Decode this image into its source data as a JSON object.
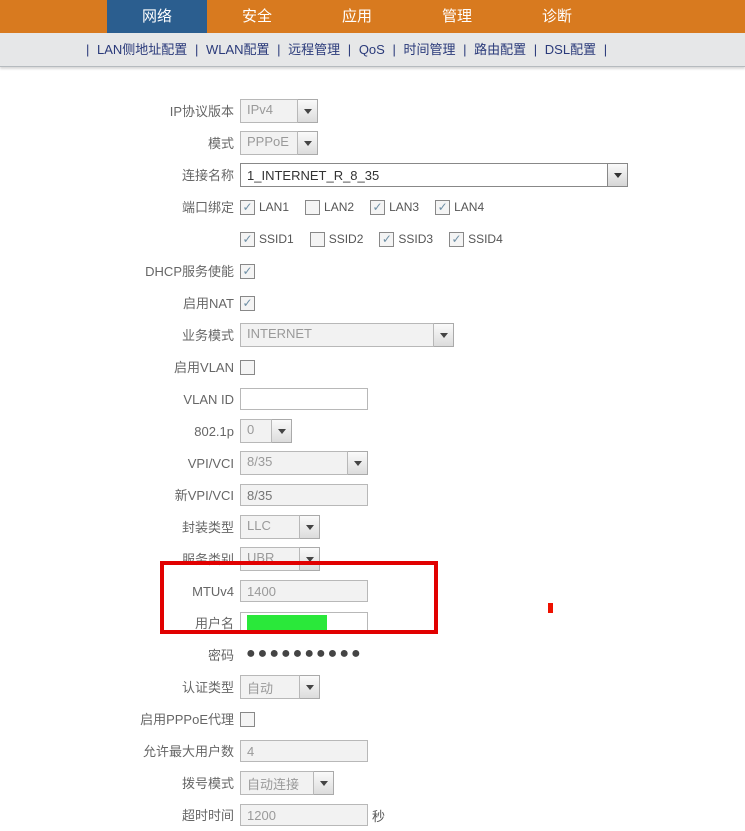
{
  "topnav": {
    "tabs": [
      "网络",
      "安全",
      "应用",
      "管理",
      "诊断"
    ],
    "active_index": 0
  },
  "subnav": {
    "items": [
      "LAN侧地址配置",
      "WLAN配置",
      "远程管理",
      "QoS",
      "时间管理",
      "路由配置",
      "DSL配置"
    ]
  },
  "form": {
    "ip_version": {
      "label": "IP协议版本",
      "value": "IPv4"
    },
    "mode": {
      "label": "模式",
      "value": "PPPoE"
    },
    "conn_name": {
      "label": "连接名称",
      "value": "1_INTERNET_R_8_35"
    },
    "port_bind": {
      "label": "端口绑定",
      "lans": [
        {
          "name": "LAN1",
          "checked": true
        },
        {
          "name": "LAN2",
          "checked": false
        },
        {
          "name": "LAN3",
          "checked": true
        },
        {
          "name": "LAN4",
          "checked": true
        }
      ],
      "ssids": [
        {
          "name": "SSID1",
          "checked": true
        },
        {
          "name": "SSID2",
          "checked": false
        },
        {
          "name": "SSID3",
          "checked": true
        },
        {
          "name": "SSID4",
          "checked": true
        }
      ]
    },
    "dhcp_enable": {
      "label": "DHCP服务使能",
      "checked": true
    },
    "nat_enable": {
      "label": "启用NAT",
      "checked": true
    },
    "service_mode": {
      "label": "业务模式",
      "value": "INTERNET"
    },
    "vlan_enable": {
      "label": "启用VLAN",
      "checked": false
    },
    "vlan_id": {
      "label": "VLAN ID",
      "value": ""
    },
    "p8021": {
      "label": "802.1p",
      "value": "0"
    },
    "vpi_vci": {
      "label": "VPI/VCI",
      "value": "8/35"
    },
    "new_vpi_vci": {
      "label": "新VPI/VCI",
      "placeholder": "8/35"
    },
    "encap": {
      "label": "封装类型",
      "value": "LLC"
    },
    "service_cat": {
      "label": "服务类别",
      "value": "UBR"
    },
    "mtu": {
      "label": "MTUv4",
      "value": "1400"
    },
    "username": {
      "label": "用户名",
      "value": ""
    },
    "password": {
      "label": "密码",
      "value": "●●●●●●●●●●"
    },
    "auth_type": {
      "label": "认证类型",
      "value": "自动"
    },
    "pppoe_proxy": {
      "label": "启用PPPoE代理",
      "checked": false
    },
    "max_users": {
      "label": "允许最大用户数",
      "value": "4"
    },
    "dial_mode": {
      "label": "拨号模式",
      "value": "自动连接"
    },
    "timeout": {
      "label": "超时时间",
      "value": "1200",
      "unit": "秒"
    }
  }
}
